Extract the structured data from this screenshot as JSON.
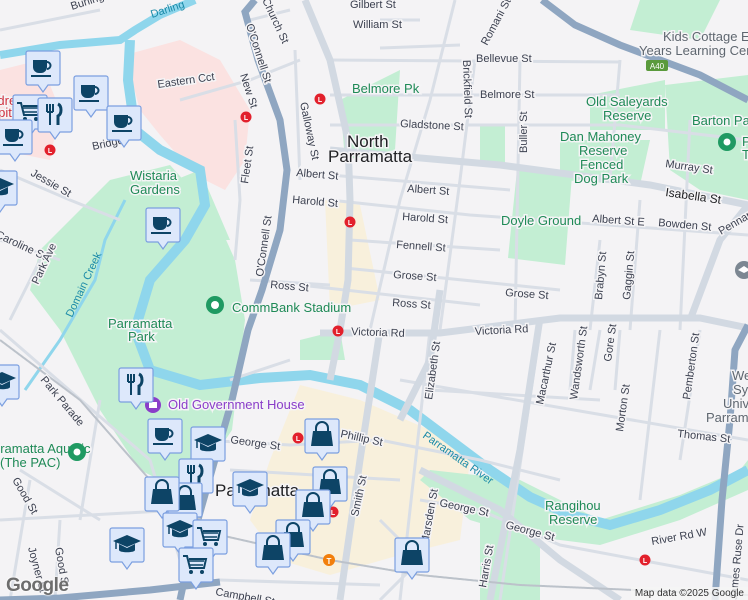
{
  "map": {
    "streets": {
      "burling": "Burling",
      "gilbert": "Gilbert St",
      "william": "William St",
      "church": "Church St",
      "oconnell_n": "O'Connell St",
      "oconnell_s": "O'Connell St",
      "new": "New St",
      "eastern": "Eastern Cct",
      "fleet": "Fleet St",
      "galloway": "Galloway St",
      "albert_w": "Albert St",
      "harold_w": "Harold St",
      "jessie": "Jessie St",
      "caroline": "Caroline St",
      "park_ave": "Park Ave",
      "bridge": "Bridge",
      "ross_w": "Ross St",
      "romani": "Romani St",
      "bellevue": "Bellevue St",
      "belmore": "Belmore St",
      "brickfield": "Brickfield St",
      "gladstone": "Gladstone St",
      "buller": "Buller St",
      "albert": "Albert St",
      "harold": "Harold St",
      "fennell": "Fennell St",
      "grose": "Grose St",
      "grose_e": "Grose St",
      "ross": "Ross St",
      "victoria_w": "Victoria Rd",
      "victoria_e": "Victoria Rd",
      "murray": "Murray St",
      "isabella": "Isabella St",
      "albert_e": "Albert St E",
      "bowden": "Bowden St",
      "pennant": "Pennant",
      "brabyn": "Brabyn St",
      "gaggin": "Gaggin St",
      "elizabeth": "Elizabeth St",
      "macarthur": "Macarthur St",
      "wandsworth": "Wandsworth St",
      "gore": "Gore St",
      "morton": "Morton St",
      "pemberton": "Pemberton St",
      "thomas": "Thomas St",
      "george_w": "George St",
      "george_e": "George St",
      "george_e2": "George St",
      "phillip": "Phillip St",
      "smith": "Smith St",
      "park_parade": "Park Parade",
      "good": "Good St",
      "good2": "Good St",
      "joyner": "Joyner St",
      "harris": "Harris St",
      "river_rd": "River Rd W",
      "james_ruse": "James Ruse Dr",
      "campbell": "Campbell St",
      "marsden": "Marsden St",
      "domain_creek": "Domain Creek",
      "darling": "Darling",
      "parramatta_river": "Parramatta River",
      "a40": "A40"
    },
    "places": {
      "north_parramatta_1": "North",
      "north_parramatta_2": "Parramatta",
      "parramatta": "Parramatta",
      "belmore_pk": "Belmore Pk",
      "wistaria_1": "Wistaria",
      "wistaria_2": "Gardens",
      "parramatta_park_1": "Parramatta",
      "parramatta_park_2": "Park",
      "commbank": "CommBank Stadium",
      "old_gov": "Old Government House",
      "pac_1": "Parramatta Aquatic",
      "pac_2": "(The PAC)",
      "doyle": "Doyle Ground",
      "old_saleyards_1": "Old Saleyards",
      "old_saleyards_2": "Reserve",
      "dan_1": "Dan Mahoney",
      "dan_2": "Reserve",
      "dan_3": "Fenced",
      "dan_4": "Dog Park",
      "barton_1": "Barton Park",
      "barton_2": "P",
      "barton_3": "T",
      "kids_1": "Kids Cottage Early",
      "kids_2": "Years Learning Centre",
      "rangihou_1": "Rangihou",
      "rangihou_2": "Reserve",
      "wsu_1": "Western",
      "wsu_2": "Sydney",
      "wsu_3": "University",
      "wsu_4": "Parramatta",
      "hospital_1": "Children's",
      "hospital_2": "Hospital"
    },
    "markers": [
      {
        "icon": "coffee"
      },
      {
        "icon": "coffee"
      },
      {
        "icon": "coffee"
      },
      {
        "icon": "cart"
      },
      {
        "icon": "cutlery"
      },
      {
        "icon": "coffee"
      },
      {
        "icon": "grad"
      },
      {
        "icon": "coffee"
      },
      {
        "icon": "grad"
      },
      {
        "icon": "cutlery"
      },
      {
        "icon": "coffee"
      },
      {
        "icon": "grad"
      },
      {
        "icon": "bag"
      },
      {
        "icon": "cutlery"
      },
      {
        "icon": "bag"
      },
      {
        "icon": "bag"
      },
      {
        "icon": "grad"
      },
      {
        "icon": "bag"
      },
      {
        "icon": "bag"
      },
      {
        "icon": "grad"
      },
      {
        "icon": "cart"
      },
      {
        "icon": "grad"
      },
      {
        "icon": "cart"
      },
      {
        "icon": "bag"
      },
      {
        "icon": "bag"
      },
      {
        "icon": "bag"
      }
    ],
    "attribution": "Map data ©2025 Google",
    "logo": "Google",
    "colors": {
      "major_road": "#8fa6c1",
      "road": "#d6dce4",
      "park": "#c3eed3",
      "water": "#8fd6ec",
      "hospital": "#fbe2e1",
      "commercial": "#f8f0dc",
      "marker_fill": "#dde8fb",
      "marker_border": "#7b9fe0",
      "marker_icon": "#0d4466",
      "rail_station": "#e2202c",
      "train": "#f27f0c"
    }
  }
}
